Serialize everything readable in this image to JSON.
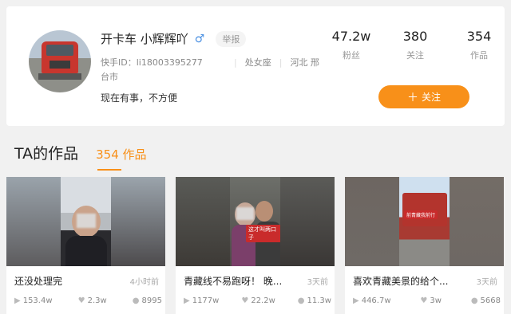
{
  "profile": {
    "nickname": "开卡车 小辉辉吖",
    "gender_icon": "male-icon",
    "report_label": "举报",
    "kuaishou_id": "快手ID：li18003395277",
    "zodiac": "处女座",
    "location_part1": "河北 邢",
    "location_part2": "台市",
    "bio": "现在有事，不方便",
    "follow_label": "关注",
    "stats": [
      {
        "value": "47.2w",
        "label": "粉丝"
      },
      {
        "value": "380",
        "label": "关注"
      },
      {
        "value": "354",
        "label": "作品"
      }
    ]
  },
  "works": {
    "title": "TA的作品",
    "tab_label": "354 作品",
    "items": [
      {
        "title": "还没处理完",
        "time": "4小时前",
        "plays": "153.4w",
        "likes": "2.3w",
        "comments": "8995"
      },
      {
        "title": "青藏线不易跑呀！ 晚...",
        "time": "3天前",
        "plays": "1177w",
        "likes": "22.2w",
        "comments": "11.3w",
        "sticker": "这才叫两口子"
      },
      {
        "title": "喜欢青藏美景的给个...",
        "time": "3天前",
        "plays": "446.7w",
        "likes": "3w",
        "comments": "5668",
        "sticker": "前青藏我前行"
      }
    ]
  },
  "colors": {
    "accent": "#f89019",
    "gender": "#4a90e2"
  }
}
